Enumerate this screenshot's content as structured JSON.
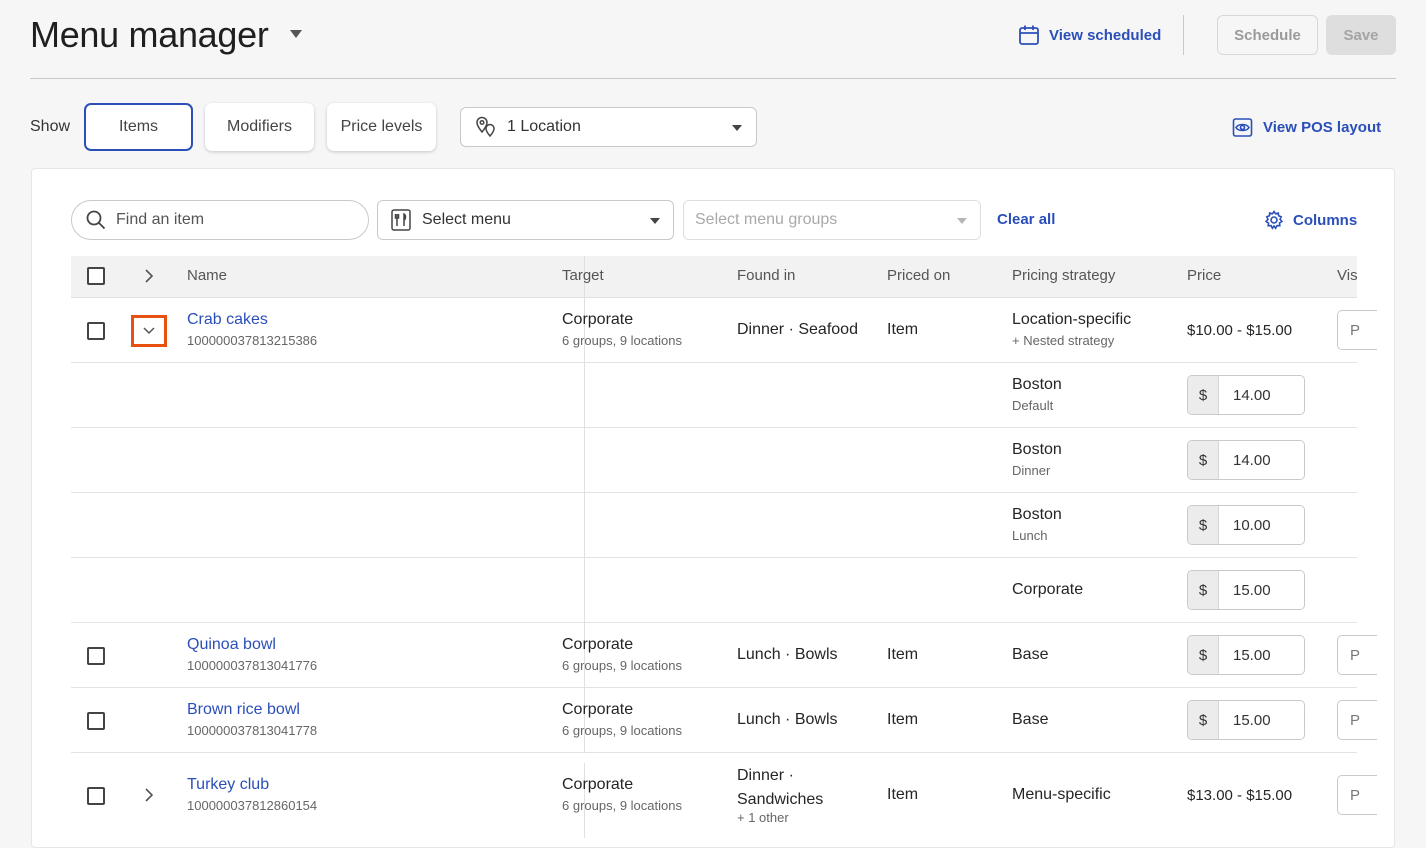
{
  "header": {
    "title": "Menu manager",
    "view_scheduled": "View scheduled",
    "schedule": "Schedule",
    "save": "Save"
  },
  "filters": {
    "show_label": "Show",
    "tabs": [
      "Items",
      "Modifiers",
      "Price levels"
    ],
    "active_tab": "Items",
    "location": "1 Location",
    "view_pos_layout": "View POS layout"
  },
  "toolbar": {
    "search_placeholder": "Find an item",
    "select_menu": "Select menu",
    "select_groups": "Select menu groups",
    "clear_all": "Clear all",
    "columns": "Columns"
  },
  "table": {
    "headers": [
      "Name",
      "Target",
      "Found in",
      "Priced on",
      "Pricing strategy",
      "Price",
      "Vis"
    ],
    "rows": [
      {
        "name": "Crab cakes",
        "id": "100000037813215386",
        "target": "Corporate",
        "target_sub": "6 groups, 9 locations",
        "found_in": "Dinner · Seafood",
        "priced_on": "Item",
        "strategy": "Location-specific",
        "strategy_sub": "+ Nested strategy",
        "price": "$10.00 - $15.00",
        "vis": "P"
      },
      {
        "strategy": "Boston",
        "strategy_sub": "Default",
        "currency": "$",
        "price_value": "14.00"
      },
      {
        "strategy": "Boston",
        "strategy_sub": "Dinner",
        "currency": "$",
        "price_value": "14.00"
      },
      {
        "strategy": "Boston",
        "strategy_sub": "Lunch",
        "currency": "$",
        "price_value": "10.00"
      },
      {
        "strategy": "Corporate",
        "currency": "$",
        "price_value": "15.00"
      },
      {
        "name": "Quinoa bowl",
        "id": "100000037813041776",
        "target": "Corporate",
        "target_sub": "6 groups, 9 locations",
        "found_in": "Lunch · Bowls",
        "priced_on": "Item",
        "strategy": "Base",
        "currency": "$",
        "price_value": "15.00",
        "vis": "P"
      },
      {
        "name": "Brown rice bowl",
        "id": "100000037813041778",
        "target": "Corporate",
        "target_sub": "6 groups, 9 locations",
        "found_in": "Lunch · Bowls",
        "priced_on": "Item",
        "strategy": "Base",
        "currency": "$",
        "price_value": "15.00",
        "vis": "P"
      },
      {
        "name": "Turkey club",
        "id": "100000037812860154",
        "target": "Corporate",
        "target_sub": "6 groups, 9 locations",
        "found_in_1": "Dinner ·",
        "found_in_2": "Sandwiches",
        "found_in_sub": "+ 1 other",
        "priced_on": "Item",
        "strategy": "Menu-specific",
        "price": "$13.00 - $15.00",
        "vis": "P"
      }
    ]
  },
  "colors": {
    "accent": "#2b4fb9",
    "highlight": "#e8500f"
  }
}
